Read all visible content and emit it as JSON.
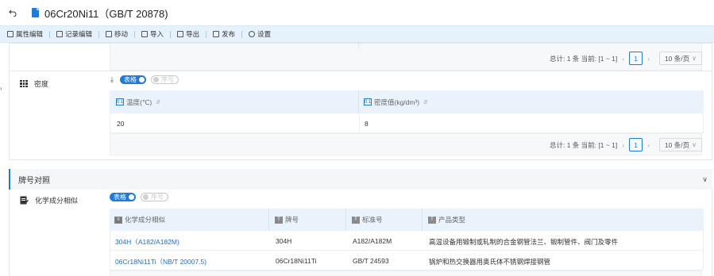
{
  "title": {
    "text": "06Cr20Ni11（GB/T 20878)"
  },
  "toolbar": {
    "items": [
      "属性编辑",
      "记录编辑",
      "移动",
      "导入",
      "导出",
      "发布",
      "设置"
    ]
  },
  "top_pager": {
    "summary": "总计: 1 条 当前: [1 ~ 1]",
    "page": "1",
    "size": "10 条/页"
  },
  "density": {
    "label": "密度",
    "toggle_on": "表格",
    "toggle_off": "序号",
    "columns": [
      "温度(℃)",
      "密度值(kg/dm³)"
    ],
    "rows": [
      [
        "20",
        "8"
      ]
    ],
    "pager": {
      "summary": "总计: 1 条 当前: [1 ~ 1]",
      "page": "1",
      "size": "10 条/页"
    }
  },
  "section": {
    "title": "牌号对照"
  },
  "chem": {
    "label": "化学成分相似",
    "toggle_on": "表格",
    "toggle_off": "序号",
    "columns": [
      "化学成分相似",
      "牌号",
      "标准号",
      "产品类型"
    ],
    "rows": [
      [
        "304H（A182/A182M)",
        "304H",
        "A182/A182M",
        "高温设备用锻制或轧制的合金钢管法兰、锻制管件、阀门及零件"
      ],
      [
        "06Cr18Ni11Ti（NB/T 20007.5)",
        "06Cr18Ni11Ti",
        "GB/T 24593",
        "锅炉和热交换器用奥氏体不锈钢焊接钢管"
      ]
    ]
  },
  "colors": {
    "accent": "#1e7bd8",
    "toolbar_bg": "#e6f2fb",
    "header_bg": "#eaf3fb"
  }
}
